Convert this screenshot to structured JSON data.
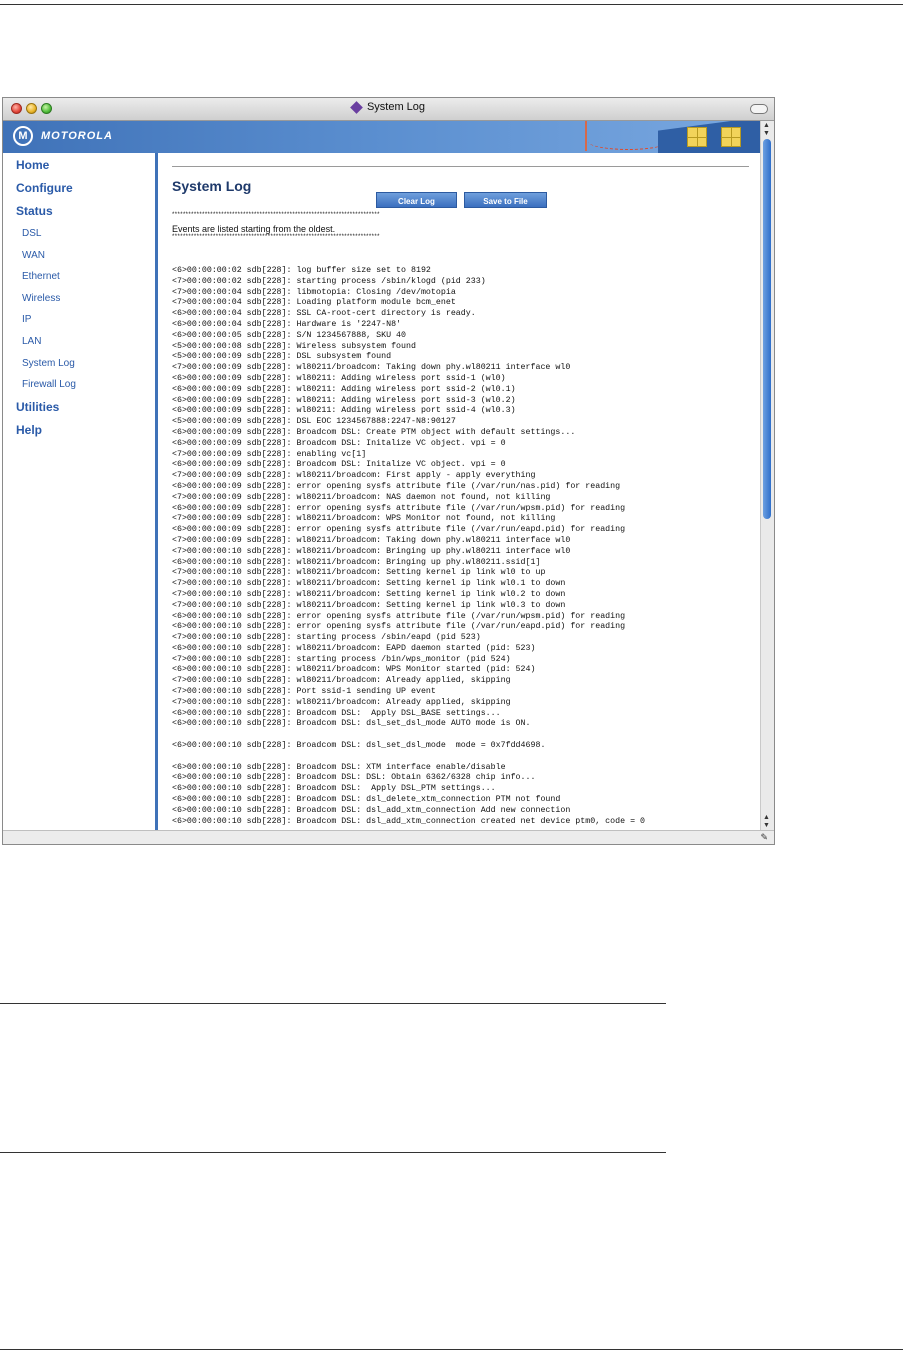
{
  "window": {
    "title": "System Log"
  },
  "brand": {
    "logo_mark": "M",
    "logo_text": "MOTOROLA"
  },
  "nav": {
    "items": [
      {
        "label": "Home",
        "level": "top"
      },
      {
        "label": "Configure",
        "level": "top"
      },
      {
        "label": "Status",
        "level": "top"
      },
      {
        "label": "DSL",
        "level": "sub"
      },
      {
        "label": "WAN",
        "level": "sub"
      },
      {
        "label": "Ethernet",
        "level": "sub"
      },
      {
        "label": "Wireless",
        "level": "sub"
      },
      {
        "label": "IP",
        "level": "sub"
      },
      {
        "label": "LAN",
        "level": "sub"
      },
      {
        "label": "System Log",
        "level": "sub"
      },
      {
        "label": "Firewall Log",
        "level": "sub"
      },
      {
        "label": "Utilities",
        "level": "top"
      },
      {
        "label": "Help",
        "level": "top"
      }
    ]
  },
  "main": {
    "title": "System Log",
    "clear_label": "Clear Log",
    "save_label": "Save to File",
    "stars": "****************************************************************************",
    "note": "Events are listed starting from the oldest."
  },
  "log": [
    "<6>00:00:00:02 sdb[228]: log buffer size set to 8192",
    "<7>00:00:00:02 sdb[228]: starting process /sbin/klogd (pid 233)",
    "<7>00:00:00:04 sdb[228]: libmotopia: Closing /dev/motopia",
    "<7>00:00:00:04 sdb[228]: Loading platform module bcm_enet",
    "<6>00:00:00:04 sdb[228]: SSL CA-root-cert directory is ready.",
    "<6>00:00:00:04 sdb[228]: Hardware is '2247-N8'",
    "<6>00:00:00:05 sdb[228]: S/N 1234567888, SKU 40",
    "<5>00:00:00:08 sdb[228]: Wireless subsystem found",
    "<5>00:00:00:09 sdb[228]: DSL subsystem found",
    "<7>00:00:00:09 sdb[228]: wl80211/broadcom: Taking down phy.wl80211 interface wl0",
    "<6>00:00:00:09 sdb[228]: wl80211: Adding wireless port ssid-1 (wl0)",
    "<6>00:00:00:09 sdb[228]: wl80211: Adding wireless port ssid-2 (wl0.1)",
    "<6>00:00:00:09 sdb[228]: wl80211: Adding wireless port ssid-3 (wl0.2)",
    "<6>00:00:00:09 sdb[228]: wl80211: Adding wireless port ssid-4 (wl0.3)",
    "<5>00:00:00:09 sdb[228]: DSL EOC 1234567888:2247-N8:90127",
    "<6>00:00:00:09 sdb[228]: Broadcom DSL: Create PTM object with default settings...",
    "<6>00:00:00:09 sdb[228]: Broadcom DSL: Initalize VC object. vpi = 0",
    "<7>00:00:00:09 sdb[228]: enabling vc[1]",
    "<6>00:00:00:09 sdb[228]: Broadcom DSL: Initalize VC object. vpi = 0",
    "<7>00:00:00:09 sdb[228]: wl80211/broadcom: First apply - apply everything",
    "<6>00:00:00:09 sdb[228]: error opening sysfs attribute file (/var/run/nas.pid) for reading",
    "<7>00:00:00:09 sdb[228]: wl80211/broadcom: NAS daemon not found, not killing",
    "<6>00:00:00:09 sdb[228]: error opening sysfs attribute file (/var/run/wpsm.pid) for reading",
    "<7>00:00:00:09 sdb[228]: wl80211/broadcom: WPS Monitor not found, not killing",
    "<6>00:00:00:09 sdb[228]: error opening sysfs attribute file (/var/run/eapd.pid) for reading",
    "<7>00:00:00:09 sdb[228]: wl80211/broadcom: Taking down phy.wl80211 interface wl0",
    "<7>00:00:00:10 sdb[228]: wl80211/broadcom: Bringing up phy.wl80211 interface wl0",
    "<6>00:00:00:10 sdb[228]: wl80211/broadcom: Bringing up phy.wl80211.ssid[1]",
    "<7>00:00:00:10 sdb[228]: wl80211/broadcom: Setting kernel ip link wl0 to up",
    "<7>00:00:00:10 sdb[228]: wl80211/broadcom: Setting kernel ip link wl0.1 to down",
    "<7>00:00:00:10 sdb[228]: wl80211/broadcom: Setting kernel ip link wl0.2 to down",
    "<7>00:00:00:10 sdb[228]: wl80211/broadcom: Setting kernel ip link wl0.3 to down",
    "<6>00:00:00:10 sdb[228]: error opening sysfs attribute file (/var/run/wpsm.pid) for reading",
    "<6>00:00:00:10 sdb[228]: error opening sysfs attribute file (/var/run/eapd.pid) for reading",
    "<7>00:00:00:10 sdb[228]: starting process /sbin/eapd (pid 523)",
    "<6>00:00:00:10 sdb[228]: wl80211/broadcom: EAPD daemon started (pid: 523)",
    "<7>00:00:00:10 sdb[228]: starting process /bin/wps_monitor (pid 524)",
    "<6>00:00:00:10 sdb[228]: wl80211/broadcom: WPS Monitor started (pid: 524)",
    "<7>00:00:00:10 sdb[228]: wl80211/broadcom: Already applied, skipping",
    "<7>00:00:00:10 sdb[228]: Port ssid-1 sending UP event",
    "<7>00:00:00:10 sdb[228]: wl80211/broadcom: Already applied, skipping",
    "<6>00:00:00:10 sdb[228]: Broadcom DSL:  Apply DSL_BASE settings...",
    "<6>00:00:00:10 sdb[228]: Broadcom DSL: dsl_set_dsl_mode AUTO mode is ON.",
    "",
    "<6>00:00:00:10 sdb[228]: Broadcom DSL: dsl_set_dsl_mode  mode = 0x7fdd4698.",
    "",
    "<6>00:00:00:10 sdb[228]: Broadcom DSL: XTM interface enable/disable",
    "<6>00:00:00:10 sdb[228]: Broadcom DSL: DSL: Obtain 6362/6328 chip info...",
    "<6>00:00:00:10 sdb[228]: Broadcom DSL:  Apply DSL_PTM settings...",
    "<6>00:00:00:10 sdb[228]: Broadcom DSL: dsl_delete_xtm_connection PTM not found",
    "<6>00:00:00:10 sdb[228]: Broadcom DSL: dsl_add_xtm_connection Add new connection",
    "<6>00:00:00:10 sdb[228]: Broadcom DSL: dsl_add_xtm_connection created net device ptm0, code = 0"
  ]
}
